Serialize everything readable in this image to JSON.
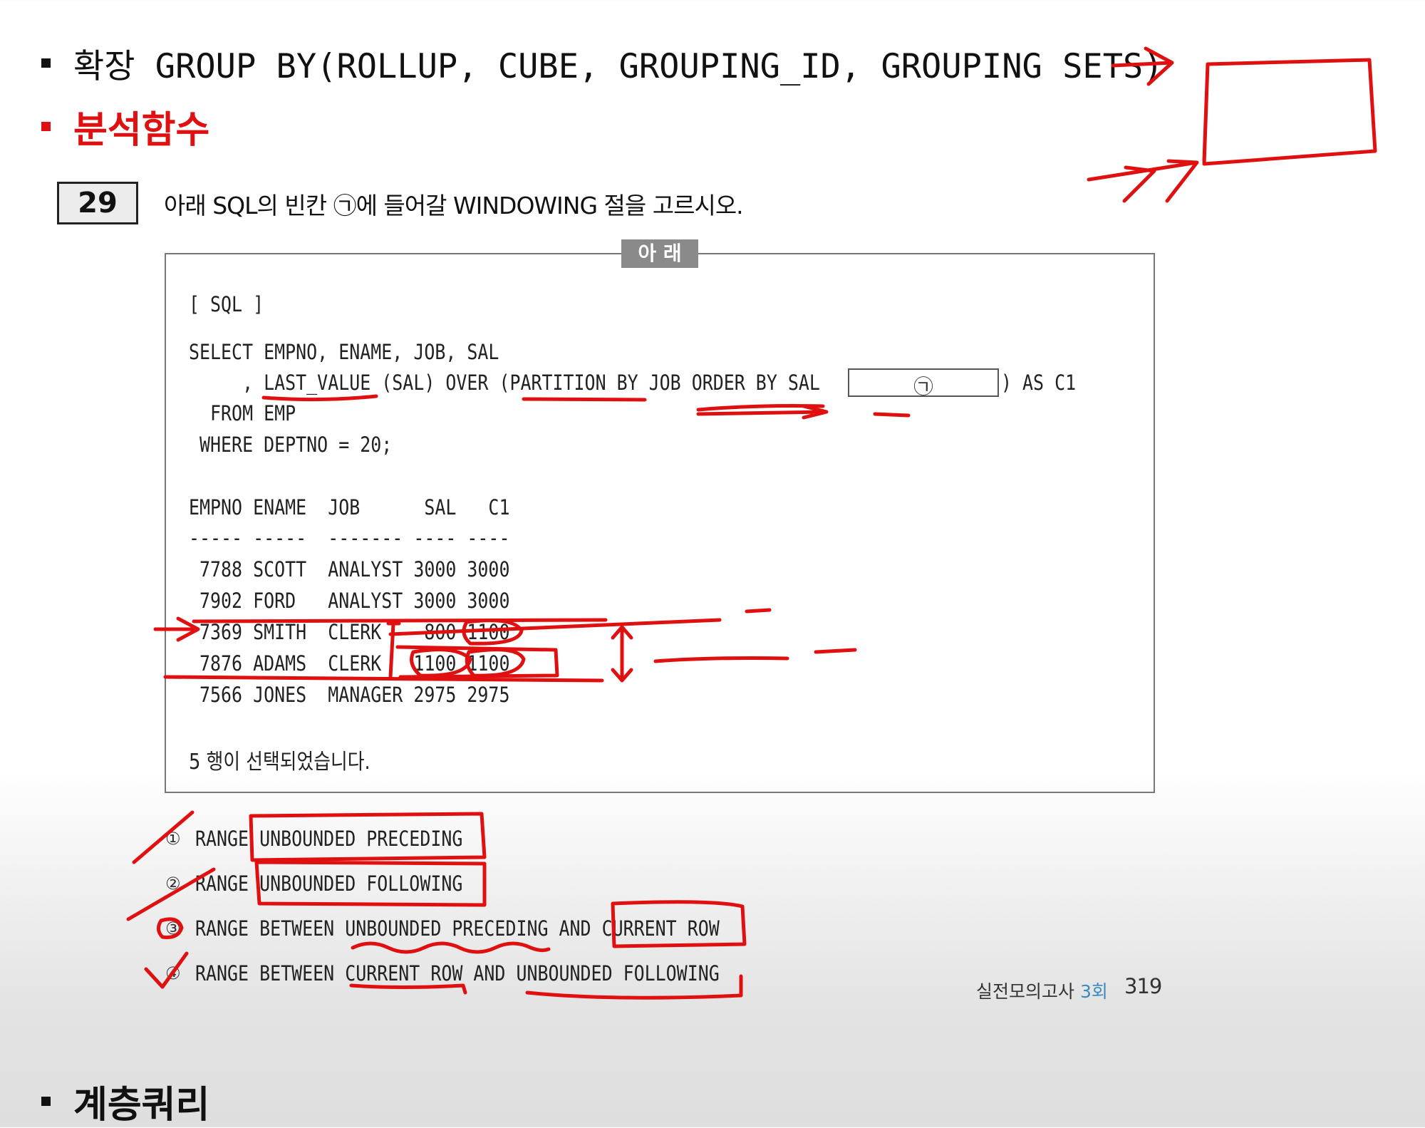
{
  "bullets": {
    "b1": "확장 GROUP BY(ROLLUP, CUBE, GROUPING_ID, GROUPING SETS)",
    "b2": "분석함수",
    "b3": "계층쿼리"
  },
  "question": {
    "number": "29",
    "text": "아래 SQL의 빈칸 ㉠에 들어갈 WINDOWING 절을 고르시오.",
    "box_label": "아 래",
    "sql_label": "[ SQL ]",
    "sql": {
      "line1": "SELECT EMPNO, ENAME, JOB, SAL",
      "line2_pre": "     , LAST_VALUE (SAL) OVER (PARTITION BY JOB ORDER BY SAL",
      "blank": "㉠",
      "line2_post": ") AS C1",
      "line3": "  FROM EMP",
      "line4": " WHERE DEPTNO = 20;"
    },
    "result": {
      "header": "EMPNO ENAME  JOB      SAL   C1",
      "divider": "----- -----  ------- ---- ----",
      "rows": [
        " 7788 SCOTT  ANALYST 3000 3000",
        " 7902 FORD   ANALYST 3000 3000",
        " 7369 SMITH  CLERK    800 1100",
        " 7876 ADAMS  CLERK   1100 1100",
        " 7566 JONES  MANAGER 2975 2975"
      ],
      "footer": "5 행이 선택되었습니다."
    },
    "options": [
      {
        "num": "①",
        "text": "RANGE UNBOUNDED PRECEDING"
      },
      {
        "num": "②",
        "text": "RANGE UNBOUNDED FOLLOWING"
      },
      {
        "num": "③",
        "text": "RANGE BETWEEN UNBOUNDED PRECEDING AND CURRENT ROW"
      },
      {
        "num": "④",
        "text": "RANGE BETWEEN CURRENT ROW AND UNBOUNDED FOLLOWING"
      }
    ]
  },
  "footer": {
    "series": "실전모의고사",
    "round": "3회",
    "page": "319"
  },
  "colors": {
    "annotation": "#e01010",
    "accent": "#3a8bbf"
  }
}
